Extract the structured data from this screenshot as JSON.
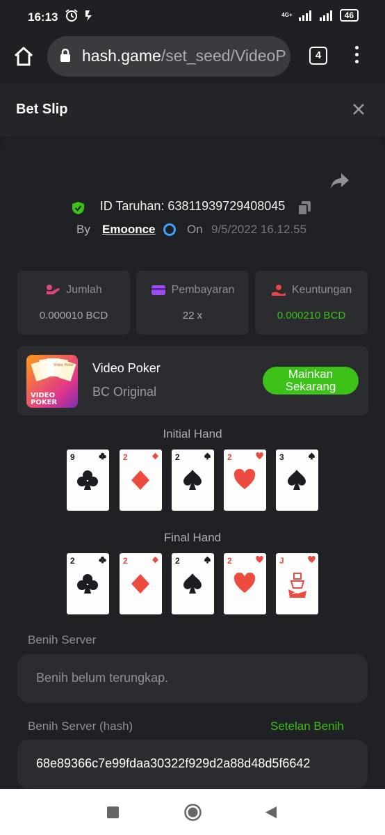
{
  "status": {
    "time": "16:13",
    "network": "4G+",
    "battery": "46"
  },
  "browser": {
    "url_host": "hash.game",
    "url_path": "/set_seed/VideoP",
    "tab_count": "4"
  },
  "header": {
    "title": "Bet Slip"
  },
  "bet": {
    "id_label": "ID Taruhan: 63811939729408045",
    "by_label": "By",
    "user": "Emoonce",
    "on_label": "On",
    "date": "9/5/2022 16.12.55"
  },
  "stats": [
    {
      "label": "Jumlah",
      "value": "0.000010 BCD"
    },
    {
      "label": "Pembayaran",
      "value": "22 x"
    },
    {
      "label": "Keuntungan",
      "value": "0.000210 BCD"
    }
  ],
  "game": {
    "name": "Video Poker",
    "provider": "BC Original",
    "play_line1": "Mainkan",
    "play_line2": "Sekarang",
    "thumb_text_1": "VIDEO",
    "thumb_text_2": "POKER",
    "thumb_card_text": "Video Poker"
  },
  "initial_hand": {
    "label": "Initial Hand",
    "cards": [
      {
        "rank": "9",
        "suit": "clubs"
      },
      {
        "rank": "2",
        "suit": "diamonds"
      },
      {
        "rank": "2",
        "suit": "spades"
      },
      {
        "rank": "2",
        "suit": "hearts"
      },
      {
        "rank": "3",
        "suit": "spades"
      }
    ]
  },
  "final_hand": {
    "label": "Final Hand",
    "cards": [
      {
        "rank": "2",
        "suit": "clubs"
      },
      {
        "rank": "2",
        "suit": "diamonds"
      },
      {
        "rank": "2",
        "suit": "spades"
      },
      {
        "rank": "2",
        "suit": "hearts"
      },
      {
        "rank": "J",
        "suit": "hearts"
      }
    ]
  },
  "seeds": {
    "server_seed_label": "Benih Server",
    "server_seed_value": "Benih belum terungkap.",
    "server_hash_label": "Benih Server (hash)",
    "settings_link": "Setelan Benih",
    "server_hash_value": "68e89366c7e99fdaa30322f929d2a88d48d5f6642"
  },
  "colors": {
    "accent_green": "#3bc117",
    "red_suit": "#ee4b40",
    "black_suit": "#1b1d22"
  }
}
